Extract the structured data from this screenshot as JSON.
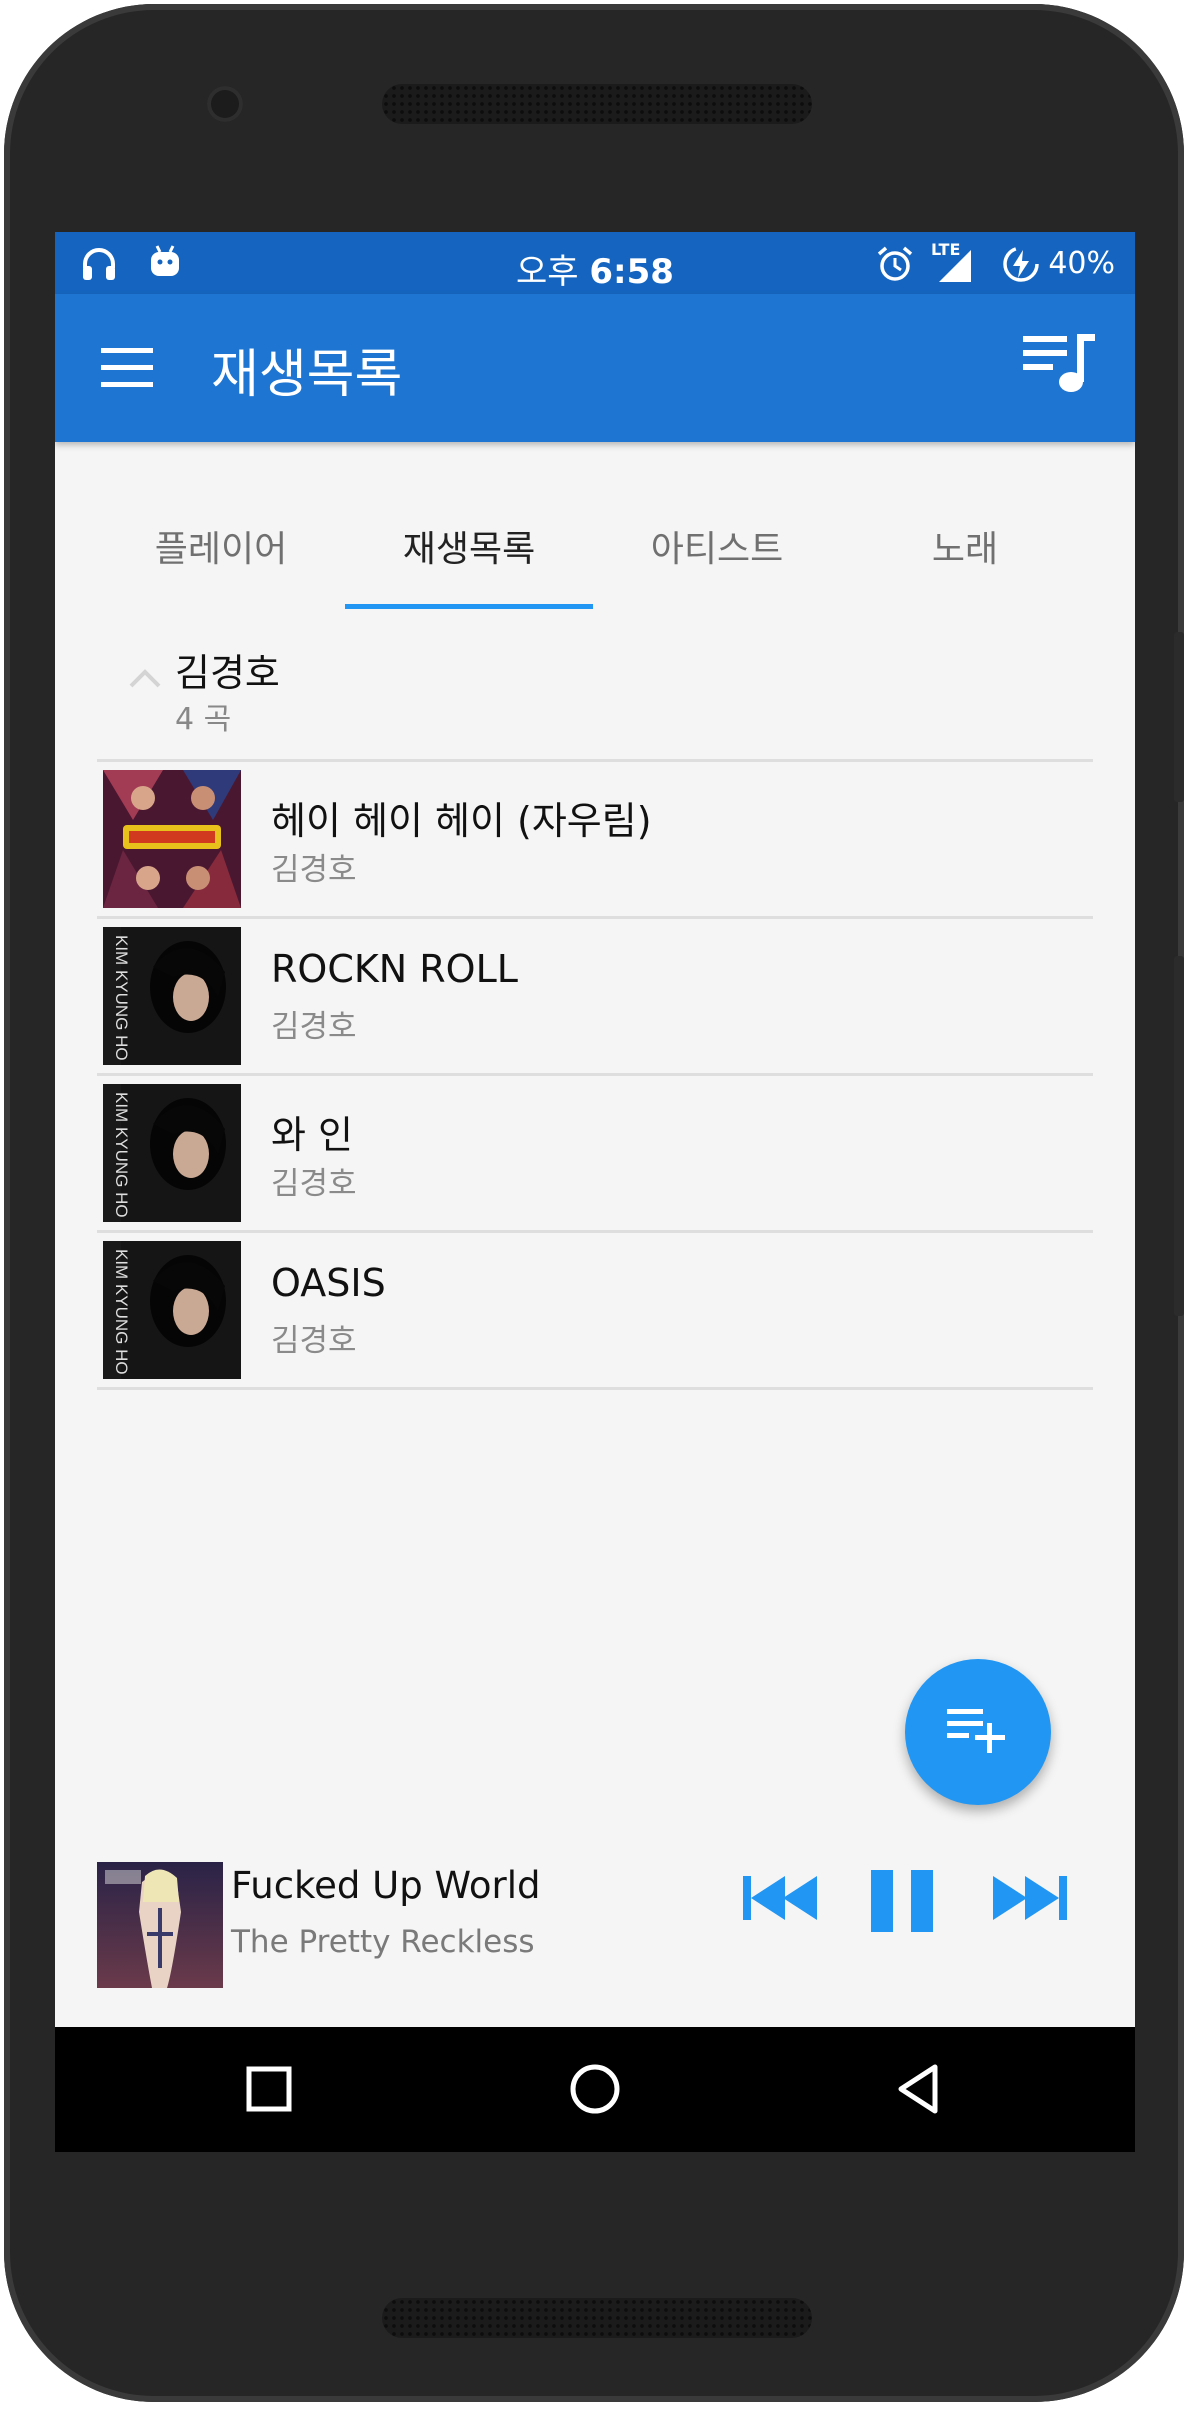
{
  "status_bar": {
    "time_prefix": "오후",
    "time": "6:58",
    "network": "LTE",
    "battery": "40%"
  },
  "app_bar": {
    "title": "재생목록"
  },
  "tabs": [
    {
      "label": "플레이어",
      "active": false
    },
    {
      "label": "재생목록",
      "active": true
    },
    {
      "label": "아티스트",
      "active": false
    },
    {
      "label": "노래",
      "active": false
    }
  ],
  "group": {
    "name": "김경호",
    "count": "4 곡"
  },
  "songs": [
    {
      "title": "헤이 헤이 헤이 (자우림)",
      "artist": "김경호"
    },
    {
      "title": "ROCKN ROLL",
      "artist": "김경호"
    },
    {
      "title": "와 인",
      "artist": "김경호"
    },
    {
      "title": "OASIS",
      "artist": "김경호"
    }
  ],
  "album_art_text": "KIM KYUNG HO",
  "now_playing": {
    "title": "Fucked Up World",
    "artist": "The Pretty Reckless"
  },
  "colors": {
    "status_bar": "#1565c0",
    "app_bar": "#1e75d2",
    "accent": "#2196f3"
  }
}
